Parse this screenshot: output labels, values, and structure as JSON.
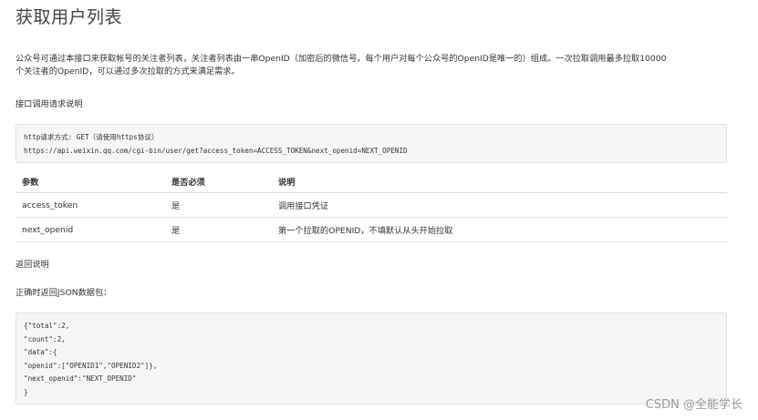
{
  "title": "获取用户列表",
  "description_line1": "公众号可通过本接口来获取帐号的关注者列表，关注者列表由一串OpenID（加密后的微信号，每个用户对每个公众号的OpenID是唯一的）组成。一次拉取调用最多拉取10000",
  "description_line2": "个关注者的OpenID，可以通过多次拉取的方式来满足需求。",
  "request_heading": "接口调用请求说明",
  "request_code": [
    "http请求方式: GET（请使用https协议）",
    "https://api.weixin.qq.com/cgi-bin/user/get?access_token=ACCESS_TOKEN&next_openid=NEXT_OPENID"
  ],
  "params_table": {
    "headers": [
      "参数",
      "是否必须",
      "说明"
    ],
    "rows": [
      [
        "access_token",
        "是",
        "调用接口凭证"
      ],
      [
        "next_openid",
        "是",
        "第一个拉取的OPENID，不填默认从头开始拉取"
      ]
    ]
  },
  "return_heading": "返回说明",
  "return_subheading": "正确时返回JSON数据包：",
  "json_code": [
    "{\"total\":2,",
    "\"count\":2,",
    "\"data\":{",
    "\"openid\":[\"OPENID1\",\"OPENID2\"]},",
    "\"next_openid\":\"NEXT_OPENID\"",
    "}"
  ],
  "watermark": "CSDN @全能学长"
}
